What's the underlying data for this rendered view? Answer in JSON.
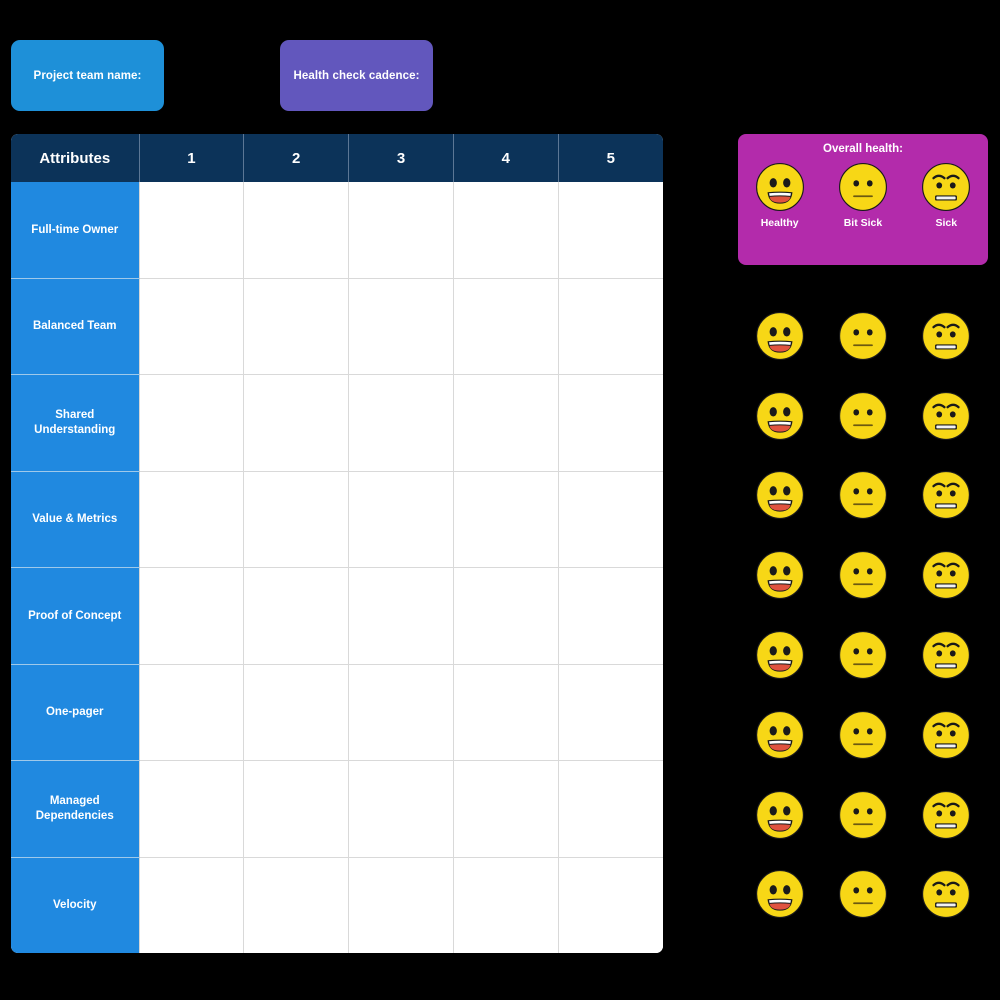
{
  "cards": [
    {
      "id": "project-team-name",
      "label": "Project team name:",
      "color": "#1e90d8"
    },
    {
      "id": "health-check-cadence",
      "label": "Health check cadence:",
      "color": "#6257bd"
    }
  ],
  "matrix": {
    "headers": [
      "Attributes",
      "1",
      "2",
      "3",
      "4",
      "5"
    ],
    "rows": [
      {
        "attribute": "Full-time Owner",
        "cells": [
          "",
          "",
          "",
          "",
          ""
        ]
      },
      {
        "attribute": "Balanced Team",
        "cells": [
          "",
          "",
          "",
          "",
          ""
        ]
      },
      {
        "attribute": "Shared Understanding",
        "cells": [
          "",
          "",
          "",
          "",
          ""
        ]
      },
      {
        "attribute": "Value & Metrics",
        "cells": [
          "",
          "",
          "",
          "",
          ""
        ]
      },
      {
        "attribute": "Proof of Concept",
        "cells": [
          "",
          "",
          "",
          "",
          ""
        ]
      },
      {
        "attribute": "One-pager",
        "cells": [
          "",
          "",
          "",
          "",
          ""
        ]
      },
      {
        "attribute": "Managed Dependencies",
        "cells": [
          "",
          "",
          "",
          "",
          ""
        ]
      },
      {
        "attribute": "Velocity",
        "cells": [
          "",
          "",
          "",
          "",
          ""
        ]
      }
    ],
    "header_color": "#0c3359",
    "label_color": "#2089e0"
  },
  "legend": {
    "title": "Overall health:",
    "panel_color": "#b32bab",
    "items": [
      {
        "caption": "Healthy",
        "icon": "grinning-face-icon"
      },
      {
        "caption": "Bit Sick",
        "icon": "neutral-face-icon"
      },
      {
        "caption": "Sick",
        "icon": "worried-face-icon"
      }
    ]
  },
  "emoji_grid": {
    "row_count": 8,
    "columns": [
      "grinning-face-icon",
      "neutral-face-icon",
      "worried-face-icon"
    ],
    "rows": [
      [
        "grinning-face-icon",
        "neutral-face-icon",
        "worried-face-icon"
      ],
      [
        "grinning-face-icon",
        "neutral-face-icon",
        "worried-face-icon"
      ],
      [
        "grinning-face-icon",
        "neutral-face-icon",
        "worried-face-icon"
      ],
      [
        "grinning-face-icon",
        "neutral-face-icon",
        "worried-face-icon"
      ],
      [
        "grinning-face-icon",
        "neutral-face-icon",
        "worried-face-icon"
      ],
      [
        "grinning-face-icon",
        "neutral-face-icon",
        "worried-face-icon"
      ],
      [
        "grinning-face-icon",
        "neutral-face-icon",
        "worried-face-icon"
      ],
      [
        "grinning-face-icon",
        "neutral-face-icon",
        "worried-face-icon"
      ]
    ],
    "face_color": "#f7d716",
    "mouth_color": "#e0533f"
  }
}
